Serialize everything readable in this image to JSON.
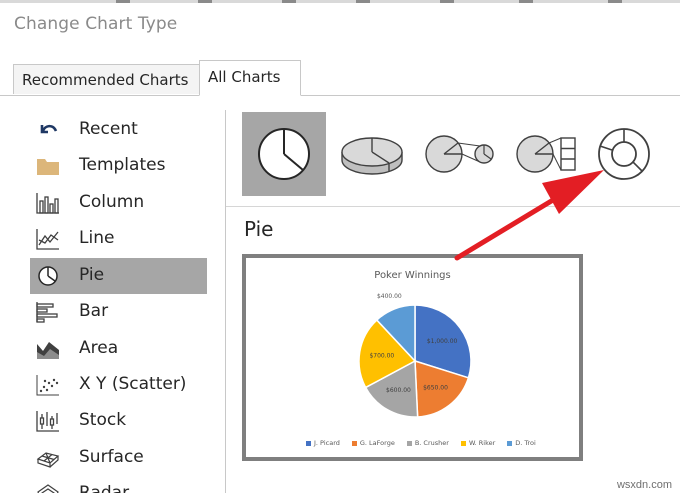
{
  "dialog": {
    "title": "Change Chart Type"
  },
  "tabs": [
    {
      "label": "Recommended Charts"
    },
    {
      "label": "All Charts"
    }
  ],
  "sidebar": {
    "selected": "Pie",
    "items": [
      {
        "label": "Recent",
        "icon": "undo-arrow-icon"
      },
      {
        "label": "Templates",
        "icon": "folder-icon"
      },
      {
        "label": "Column",
        "icon": "column-chart-icon"
      },
      {
        "label": "Line",
        "icon": "line-chart-icon"
      },
      {
        "label": "Pie",
        "icon": "pie-chart-icon"
      },
      {
        "label": "Bar",
        "icon": "bar-chart-icon"
      },
      {
        "label": "Area",
        "icon": "area-chart-icon"
      },
      {
        "label": "X Y (Scatter)",
        "icon": "scatter-chart-icon"
      },
      {
        "label": "Stock",
        "icon": "stock-chart-icon"
      },
      {
        "label": "Surface",
        "icon": "surface-chart-icon"
      },
      {
        "label": "Radar",
        "icon": "radar-chart-icon"
      }
    ]
  },
  "subtypes": [
    {
      "name": "pie",
      "icon": "pie-subtype-icon",
      "selected": true
    },
    {
      "name": "3-d-pie",
      "icon": "pie-3d-subtype-icon",
      "selected": false
    },
    {
      "name": "pie-of-pie",
      "icon": "pie-of-pie-subtype-icon",
      "selected": false
    },
    {
      "name": "bar-of-pie",
      "icon": "bar-of-pie-subtype-icon",
      "selected": false
    },
    {
      "name": "doughnut",
      "icon": "doughnut-subtype-icon",
      "selected": false
    }
  ],
  "section_title": "Pie",
  "annotation": {
    "color": "#e31e24",
    "points_to": "doughnut"
  },
  "chart_data": {
    "type": "pie",
    "title": "Poker Winnings",
    "categories": [
      "J. Picard",
      "G. LaForge",
      "B. Crusher",
      "W. Riker",
      "D. Troi"
    ],
    "values": [
      1000.0,
      650.0,
      600.0,
      700.0,
      400.0
    ],
    "data_labels": [
      "$1,000.00",
      "$650.00",
      "$600.00",
      "$700.00",
      "$400.00"
    ],
    "colors": [
      "#4472c4",
      "#ed7d31",
      "#a5a5a5",
      "#ffc000",
      "#5b9bd5"
    ],
    "legend_position": "bottom"
  },
  "watermark": "wsxdn.com"
}
